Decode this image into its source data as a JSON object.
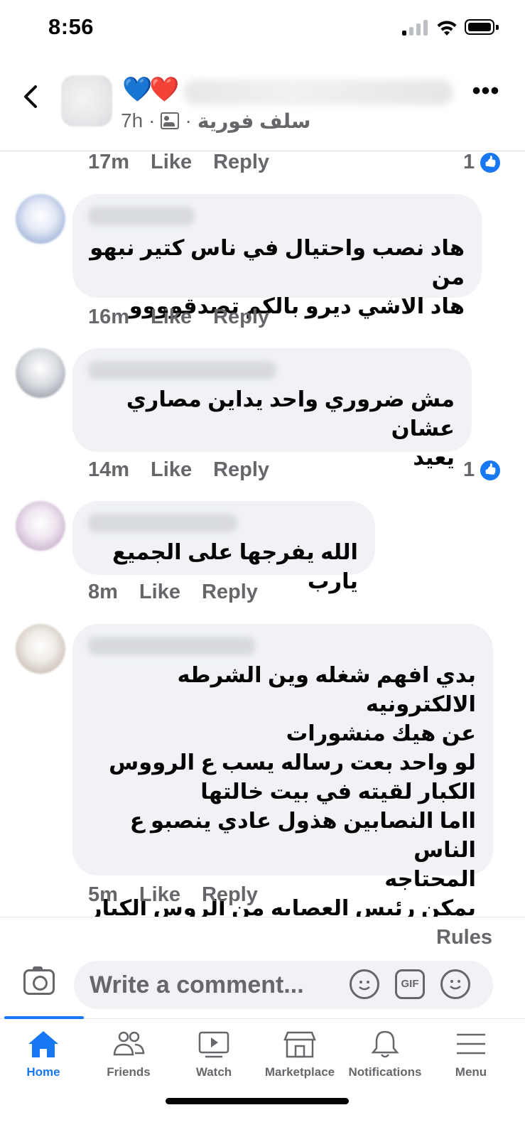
{
  "status_bar": {
    "time": "8:56"
  },
  "header": {
    "hearts": "💙❤️",
    "post_age": "7h",
    "separator": "·",
    "group_name": "سلف فورية",
    "back_icon": "chevron-left-icon",
    "more_icon": "more-horizontal-icon"
  },
  "comments": [
    {
      "time": "17m",
      "like": "Like",
      "reply": "Reply",
      "reactions": "1"
    },
    {
      "text": "هاد نصب واحتيال في ناس كتير نبهو من\nهاد الاشي ديرو بالكم تصدقوووو",
      "time": "16m",
      "like": "Like",
      "reply": "Reply",
      "reactions": ""
    },
    {
      "text": "مش ضروري واحد يداين مصاري عشان\nيعيد",
      "time": "14m",
      "like": "Like",
      "reply": "Reply",
      "reactions": "1"
    },
    {
      "text": "الله يفرجها على الجميع يارب",
      "time": "8m",
      "like": "Like",
      "reply": "Reply",
      "reactions": ""
    },
    {
      "text": "بدي افهم شغله وين الشرطه الالكترونيه\nعن هيك منشورات\nلو واحد بعت رساله يسب ع الرووس\nالكبار لقيته في بيت خالتها\nااما النصابين هذول عادي ينصبو ع الناس\nالمحتاجه\nيمكن رئيس العصابه من الروس الكبار",
      "time": "5m",
      "like": "Like",
      "reply": "Reply",
      "reactions": ""
    }
  ],
  "composer": {
    "rules": "Rules",
    "placeholder": "Write a comment...",
    "gif": "GIF"
  },
  "tabs": [
    {
      "label": "Home",
      "icon": "home-icon",
      "active": true
    },
    {
      "label": "Friends",
      "icon": "friends-icon",
      "active": false
    },
    {
      "label": "Watch",
      "icon": "watch-icon",
      "active": false
    },
    {
      "label": "Marketplace",
      "icon": "marketplace-icon",
      "active": false
    },
    {
      "label": "Notifications",
      "icon": "bell-icon",
      "active": false
    },
    {
      "label": "Menu",
      "icon": "menu-icon",
      "active": false
    }
  ],
  "colors": {
    "accent": "#1877f2",
    "bubble": "#f0f2f5",
    "muted": "#65676b"
  }
}
